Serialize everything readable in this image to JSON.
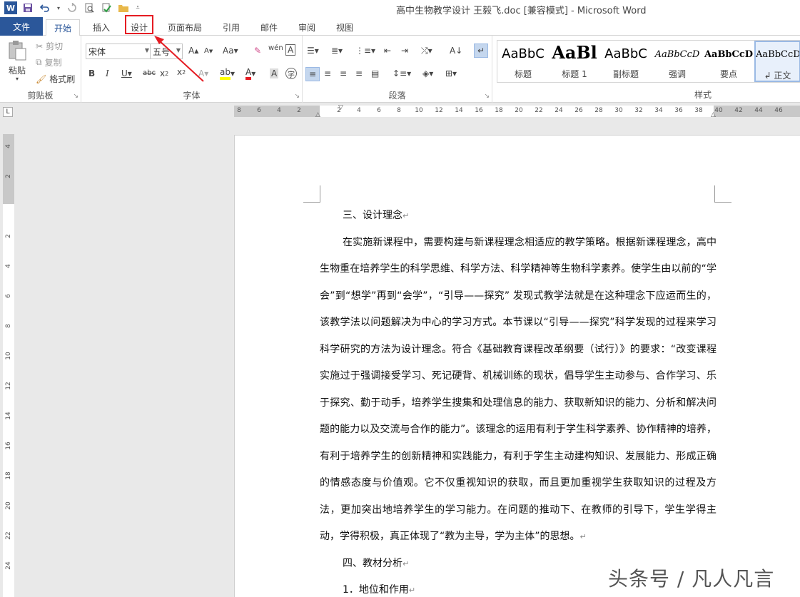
{
  "window": {
    "title": "高中生物教学设计 王毅飞.doc [兼容模式] - Microsoft Word"
  },
  "tabs": [
    {
      "label": "文件"
    },
    {
      "label": "开始"
    },
    {
      "label": "插入"
    },
    {
      "label": "设计"
    },
    {
      "label": "页面布局"
    },
    {
      "label": "引用"
    },
    {
      "label": "邮件"
    },
    {
      "label": "审阅"
    },
    {
      "label": "视图"
    }
  ],
  "clipboard": {
    "paste_label": "粘贴",
    "cut_label": "剪切",
    "copy_label": "复制",
    "format_painter_label": "格式刷",
    "group_label": "剪贴板"
  },
  "font": {
    "font_name": "宋体",
    "font_size": "五号",
    "group_label": "字体"
  },
  "paragraph": {
    "group_label": "段落"
  },
  "styles": {
    "group_label": "样式",
    "items": [
      {
        "sample": "AaBbC",
        "name": "标题"
      },
      {
        "sample": "AaBl",
        "name": "标题 1"
      },
      {
        "sample": "AaBbC",
        "name": "副标题"
      },
      {
        "sample": "AaBbCcD",
        "name": "强调"
      },
      {
        "sample": "AaBbCcD",
        "name": "要点"
      },
      {
        "sample": "AaBbCcDd",
        "name": "↲ 正文"
      }
    ]
  },
  "ruler": {
    "horizontal": [
      "8",
      "6",
      "4",
      "2",
      "",
      "2",
      "4",
      "6",
      "8",
      "10",
      "12",
      "14",
      "16",
      "18",
      "20",
      "22",
      "24",
      "26",
      "28",
      "30",
      "32",
      "34",
      "36",
      "38",
      "40",
      "42",
      "44",
      "46"
    ],
    "vertical": [
      "4",
      "2",
      "",
      "2",
      "4",
      "6",
      "8",
      "10",
      "12",
      "14",
      "16",
      "18",
      "20",
      "22",
      "24"
    ]
  },
  "document": {
    "paragraphs": [
      {
        "text": "三、设计理念",
        "mark": "↵",
        "indent": true
      },
      {
        "text": "在实施新课程中，需要构建与新课程理念相适应的教学策略。根据新课程理念，高中生物重在培养学生的科学思维、科学方法、科学精神等生物科学素养。使学生由以前的“学会”到“想学”再到“会学”，“引导——探究” 发现式教学法就是在这种理念下应运而生的，该教学法以问题解决为中心的学习方式。本节课以“引导——探究”科学发现的过程来学习科学研究的方法为设计理念。符合《基础教育课程改革纲要（试行）》的要求：“改变课程实施过于强调接受学习、死记硬背、机械训练的现状，倡导学生主动参与、合作学习、乐于探究、勤于动手，培养学生搜集和处理信息的能力、获取新知识的能力、分析和解决问题的能力以及交流与合作的能力”。该理念的运用有利于学生科学素养、协作精神的培养，有利于培养学生的创新精神和实践能力，有利于学生主动建构知识、发展能力、形成正确的情感态度与价值观。它不仅重视知识的获取，而且更加重视学生获取知识的过程及方法，更加突出地培养学生的学习能力。在问题的推动下、在教师的引导下，学生学得主动，学得积极，真正体现了“教为主导，学为主体”的思想。",
        "mark": "↵",
        "indent": true
      },
      {
        "text": "四、教材分析",
        "mark": "↵",
        "indent": true
      },
      {
        "text": "1．地位和作用",
        "mark": "↵",
        "indent": true
      }
    ]
  },
  "watermark": {
    "text": "头条号 / 凡人凡言"
  },
  "colors": {
    "accent": "#2b579a",
    "highlight_box": "#e51c23",
    "arrow": "#e51c23"
  }
}
